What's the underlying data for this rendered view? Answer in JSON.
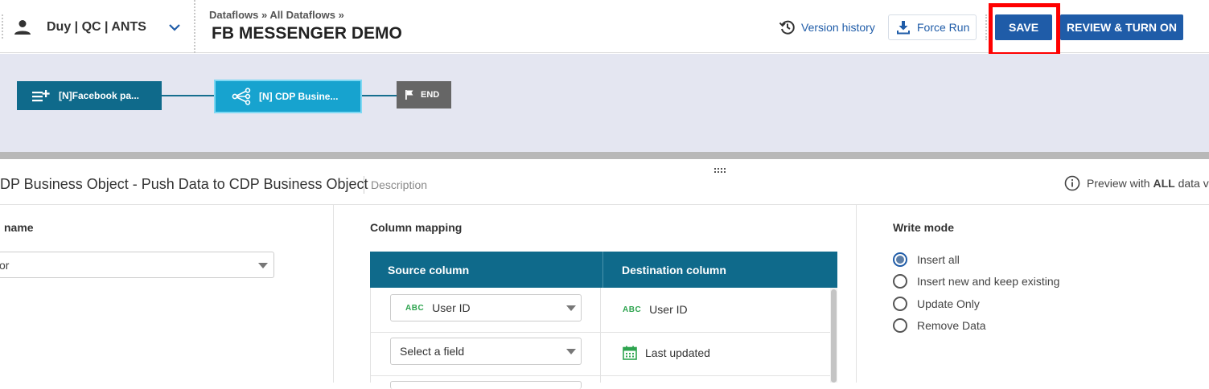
{
  "header": {
    "account_name": "Duy | QC | ANTS",
    "breadcrumb": "Dataflows » All Dataflows »",
    "title": "FB MESSENGER DEMO",
    "version_history_label": "Version history",
    "force_run_label": "Force Run",
    "save_label": "SAVE",
    "review_label": "REVIEW & TURN ON"
  },
  "flow": {
    "nodes": [
      {
        "label": "[N]Facebook pa..."
      },
      {
        "label": "[N] CDP Busine..."
      },
      {
        "label": "END"
      }
    ]
  },
  "panel": {
    "title": "DP Business Object - Push Data to CDP Business Object",
    "description_label": "Description",
    "preview_text_prefix": "Preview with ",
    "preview_text_bold": "ALL",
    "preview_text_suffix": " data v"
  },
  "left": {
    "label": "name",
    "dropdown_value": "or"
  },
  "mapping": {
    "label": "Column mapping",
    "headers": [
      "Source column",
      "Destination column"
    ],
    "rows": [
      {
        "source_type": "ABC",
        "source": "User ID",
        "dest_type": "ABC",
        "dest": "User ID"
      },
      {
        "source": "Select a field",
        "dest": "Last updated"
      }
    ]
  },
  "write_mode": {
    "label": "Write mode",
    "options": [
      "Insert all",
      "Insert new and keep existing",
      "Update Only",
      "Remove Data"
    ],
    "selected_index": 0
  },
  "colors": {
    "primary": "#1f5ca8",
    "node_dark": "#0f6a8b",
    "node_active": "#17a3cf",
    "highlight": "#ff0000"
  }
}
